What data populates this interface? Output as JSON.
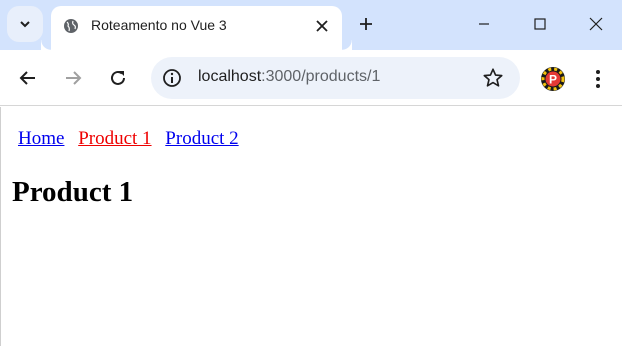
{
  "browser": {
    "tab": {
      "title": "Roteamento no Vue 3"
    },
    "address": {
      "host": "localhost",
      "path": ":3000/products/1"
    },
    "icons": {
      "tab_search": "chevron-down-icon",
      "favicon": "globe-icon",
      "tab_close": "close-icon",
      "new_tab": "plus-icon",
      "minimize": "minimize-icon",
      "maximize": "maximize-icon",
      "window_close": "close-icon",
      "back": "arrow-left-icon",
      "forward": "arrow-right-icon",
      "reload": "reload-icon",
      "site_info": "info-icon",
      "bookmark": "star-icon",
      "extension": "extension-icon",
      "menu": "kebab-menu-icon"
    },
    "colors": {
      "tabstrip": "#d3e3fd",
      "omnibox": "#edf2fa"
    }
  },
  "page": {
    "nav": [
      {
        "label": "Home",
        "active": false
      },
      {
        "label": "Product 1",
        "active": true
      },
      {
        "label": "Product 2",
        "active": false
      }
    ],
    "heading": "Product 1",
    "colors": {
      "link": "#0000ee",
      "active_link": "#ee0000"
    }
  }
}
